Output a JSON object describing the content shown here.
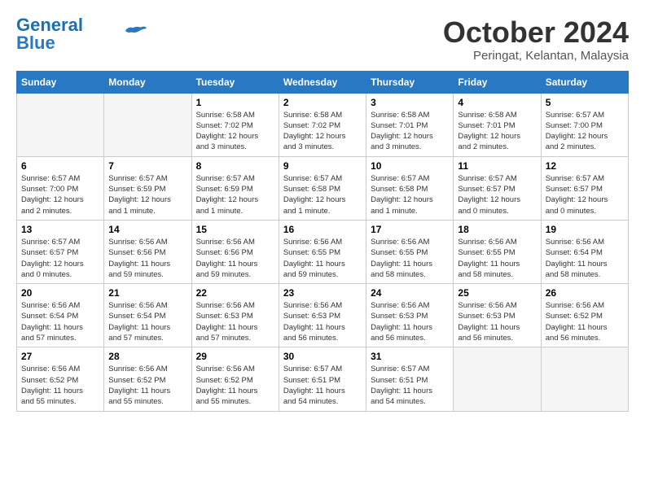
{
  "logo": {
    "name_part1": "General",
    "name_part2": "Blue"
  },
  "header": {
    "month": "October 2024",
    "location": "Peringat, Kelantan, Malaysia"
  },
  "weekdays": [
    "Sunday",
    "Monday",
    "Tuesday",
    "Wednesday",
    "Thursday",
    "Friday",
    "Saturday"
  ],
  "weeks": [
    [
      {
        "day": "",
        "info": ""
      },
      {
        "day": "",
        "info": ""
      },
      {
        "day": "1",
        "info": "Sunrise: 6:58 AM\nSunset: 7:02 PM\nDaylight: 12 hours\nand 3 minutes."
      },
      {
        "day": "2",
        "info": "Sunrise: 6:58 AM\nSunset: 7:02 PM\nDaylight: 12 hours\nand 3 minutes."
      },
      {
        "day": "3",
        "info": "Sunrise: 6:58 AM\nSunset: 7:01 PM\nDaylight: 12 hours\nand 3 minutes."
      },
      {
        "day": "4",
        "info": "Sunrise: 6:58 AM\nSunset: 7:01 PM\nDaylight: 12 hours\nand 2 minutes."
      },
      {
        "day": "5",
        "info": "Sunrise: 6:57 AM\nSunset: 7:00 PM\nDaylight: 12 hours\nand 2 minutes."
      }
    ],
    [
      {
        "day": "6",
        "info": "Sunrise: 6:57 AM\nSunset: 7:00 PM\nDaylight: 12 hours\nand 2 minutes."
      },
      {
        "day": "7",
        "info": "Sunrise: 6:57 AM\nSunset: 6:59 PM\nDaylight: 12 hours\nand 1 minute."
      },
      {
        "day": "8",
        "info": "Sunrise: 6:57 AM\nSunset: 6:59 PM\nDaylight: 12 hours\nand 1 minute."
      },
      {
        "day": "9",
        "info": "Sunrise: 6:57 AM\nSunset: 6:58 PM\nDaylight: 12 hours\nand 1 minute."
      },
      {
        "day": "10",
        "info": "Sunrise: 6:57 AM\nSunset: 6:58 PM\nDaylight: 12 hours\nand 1 minute."
      },
      {
        "day": "11",
        "info": "Sunrise: 6:57 AM\nSunset: 6:57 PM\nDaylight: 12 hours\nand 0 minutes."
      },
      {
        "day": "12",
        "info": "Sunrise: 6:57 AM\nSunset: 6:57 PM\nDaylight: 12 hours\nand 0 minutes."
      }
    ],
    [
      {
        "day": "13",
        "info": "Sunrise: 6:57 AM\nSunset: 6:57 PM\nDaylight: 12 hours\nand 0 minutes."
      },
      {
        "day": "14",
        "info": "Sunrise: 6:56 AM\nSunset: 6:56 PM\nDaylight: 11 hours\nand 59 minutes."
      },
      {
        "day": "15",
        "info": "Sunrise: 6:56 AM\nSunset: 6:56 PM\nDaylight: 11 hours\nand 59 minutes."
      },
      {
        "day": "16",
        "info": "Sunrise: 6:56 AM\nSunset: 6:55 PM\nDaylight: 11 hours\nand 59 minutes."
      },
      {
        "day": "17",
        "info": "Sunrise: 6:56 AM\nSunset: 6:55 PM\nDaylight: 11 hours\nand 58 minutes."
      },
      {
        "day": "18",
        "info": "Sunrise: 6:56 AM\nSunset: 6:55 PM\nDaylight: 11 hours\nand 58 minutes."
      },
      {
        "day": "19",
        "info": "Sunrise: 6:56 AM\nSunset: 6:54 PM\nDaylight: 11 hours\nand 58 minutes."
      }
    ],
    [
      {
        "day": "20",
        "info": "Sunrise: 6:56 AM\nSunset: 6:54 PM\nDaylight: 11 hours\nand 57 minutes."
      },
      {
        "day": "21",
        "info": "Sunrise: 6:56 AM\nSunset: 6:54 PM\nDaylight: 11 hours\nand 57 minutes."
      },
      {
        "day": "22",
        "info": "Sunrise: 6:56 AM\nSunset: 6:53 PM\nDaylight: 11 hours\nand 57 minutes."
      },
      {
        "day": "23",
        "info": "Sunrise: 6:56 AM\nSunset: 6:53 PM\nDaylight: 11 hours\nand 56 minutes."
      },
      {
        "day": "24",
        "info": "Sunrise: 6:56 AM\nSunset: 6:53 PM\nDaylight: 11 hours\nand 56 minutes."
      },
      {
        "day": "25",
        "info": "Sunrise: 6:56 AM\nSunset: 6:53 PM\nDaylight: 11 hours\nand 56 minutes."
      },
      {
        "day": "26",
        "info": "Sunrise: 6:56 AM\nSunset: 6:52 PM\nDaylight: 11 hours\nand 56 minutes."
      }
    ],
    [
      {
        "day": "27",
        "info": "Sunrise: 6:56 AM\nSunset: 6:52 PM\nDaylight: 11 hours\nand 55 minutes."
      },
      {
        "day": "28",
        "info": "Sunrise: 6:56 AM\nSunset: 6:52 PM\nDaylight: 11 hours\nand 55 minutes."
      },
      {
        "day": "29",
        "info": "Sunrise: 6:56 AM\nSunset: 6:52 PM\nDaylight: 11 hours\nand 55 minutes."
      },
      {
        "day": "30",
        "info": "Sunrise: 6:57 AM\nSunset: 6:51 PM\nDaylight: 11 hours\nand 54 minutes."
      },
      {
        "day": "31",
        "info": "Sunrise: 6:57 AM\nSunset: 6:51 PM\nDaylight: 11 hours\nand 54 minutes."
      },
      {
        "day": "",
        "info": ""
      },
      {
        "day": "",
        "info": ""
      }
    ]
  ]
}
